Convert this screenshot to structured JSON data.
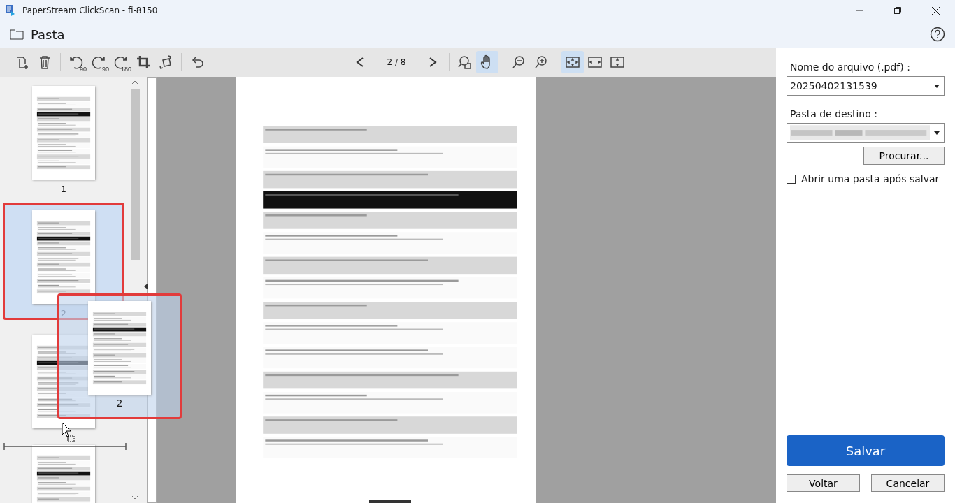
{
  "window": {
    "title": "PaperStream ClickScan - fi-8150"
  },
  "header": {
    "title": "Pasta"
  },
  "toolbar": {
    "left_groups": [
      [
        {
          "kind": "add-page"
        },
        {
          "kind": "delete"
        }
      ],
      [
        {
          "kind": "rotate-left",
          "badge": "90"
        },
        {
          "kind": "rotate-right",
          "badge": "90"
        },
        {
          "kind": "rotate-right",
          "badge": "180"
        },
        {
          "kind": "crop"
        },
        {
          "kind": "deskew"
        }
      ],
      [
        {
          "kind": "undo"
        }
      ]
    ],
    "page_indicator": "2 / 8",
    "view_groups": [
      [
        {
          "kind": "zoom-area",
          "selected": false
        },
        {
          "kind": "hand",
          "selected": true
        }
      ],
      [
        {
          "kind": "zoom-out",
          "selected": false
        },
        {
          "kind": "zoom-in",
          "selected": false
        }
      ],
      [
        {
          "kind": "fit-page",
          "selected": true
        },
        {
          "kind": "fit-width",
          "selected": false
        },
        {
          "kind": "fit-height",
          "selected": false
        }
      ]
    ]
  },
  "thumbnails": [
    {
      "label": "1",
      "selected": false
    },
    {
      "label": "2",
      "selected": true
    },
    {
      "selected": false
    },
    {
      "selected": false
    }
  ],
  "drag_ghost": {
    "label": "2"
  },
  "panel": {
    "file_name_label": "Nome do arquivo  (.pdf)  :",
    "file_name": "20250402131539",
    "folder_label": "Pasta de destino   :",
    "browse": "Procurar...",
    "open_folder": {
      "label": "Abrir uma pasta após salvar",
      "checked": false
    },
    "save": "Salvar",
    "back": "Voltar",
    "cancel": "Cancelar"
  }
}
